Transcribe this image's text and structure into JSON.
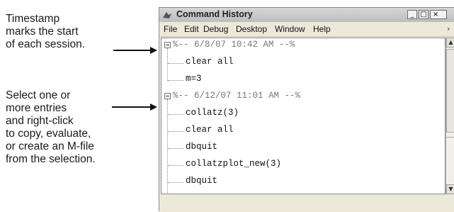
{
  "annotations": {
    "callout_1": [
      "Timestamp",
      "marks the start",
      "of each session."
    ],
    "callout_2": [
      "Select one or",
      "more entries",
      "and right-click",
      "to copy, evaluate,",
      "or create an M-file",
      "from the selection."
    ]
  },
  "window": {
    "title": "Command History",
    "controls": {
      "minimize": "_",
      "maximize": "□",
      "close": "×"
    }
  },
  "menu": [
    "File",
    "Edit",
    "Debug",
    "Desktop",
    "Window",
    "Help"
  ],
  "menu_overflow": "›",
  "history": {
    "sessions": [
      {
        "timestamp": "%-- 6/8/07 10:42 AM --%",
        "entries": [
          "clear all",
          "m=3"
        ]
      },
      {
        "timestamp": "%-- 6/12/07 11:01 AM --%",
        "entries": [
          "collatz(3)",
          "clear all",
          "dbquit",
          "collatzplot_new(3)",
          "dbquit"
        ]
      }
    ]
  },
  "scrollbar": {
    "up": "▲",
    "down": "▼"
  },
  "colors": {
    "window_bg": "#ece9d8",
    "content_bg": "#ffffff",
    "timestamp_text": "#777777"
  }
}
